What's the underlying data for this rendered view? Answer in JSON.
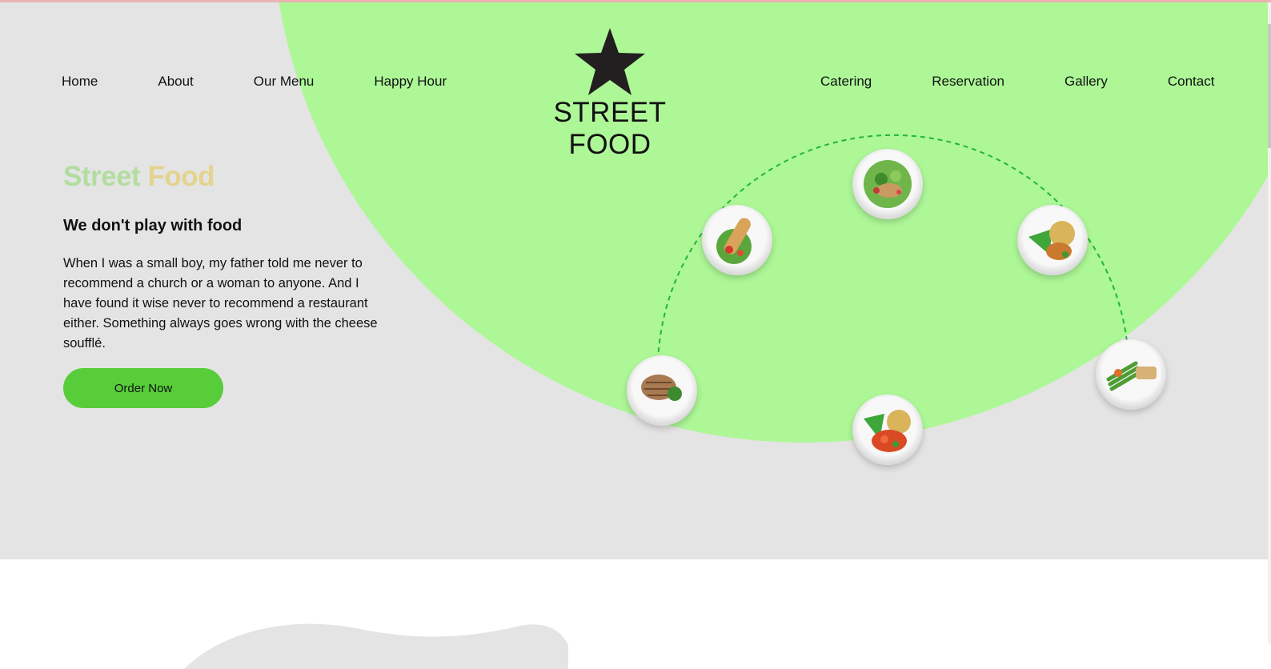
{
  "nav": {
    "left_items": [
      {
        "label": "Home"
      },
      {
        "label": "About"
      },
      {
        "label": "Our Menu"
      },
      {
        "label": "Happy Hour"
      }
    ],
    "right_items": [
      {
        "label": "Catering"
      },
      {
        "label": "Reservation"
      },
      {
        "label": "Gallery"
      },
      {
        "label": "Contact"
      }
    ]
  },
  "brand": {
    "logo_icon": "star-icon",
    "name": "STREET FOOD"
  },
  "hero": {
    "headline_word1": "Street",
    "headline_word2": "Food",
    "subheading": "We don't play with food",
    "description": "When I was a small boy, my father told me never to recommend a church or a woman to anyone. And I have found it wise never to recommend a restaurant either. Something always goes wrong with the cheese soufflé.",
    "cta_label": "Order Now"
  },
  "colors": {
    "hero_bg": "#e4e4e4",
    "blob": "#adf797",
    "accent_green": "#57cd3a",
    "dash_line": "#22b53a",
    "headline_green": "#b2dd9f",
    "headline_yellow": "#e3d38d"
  }
}
